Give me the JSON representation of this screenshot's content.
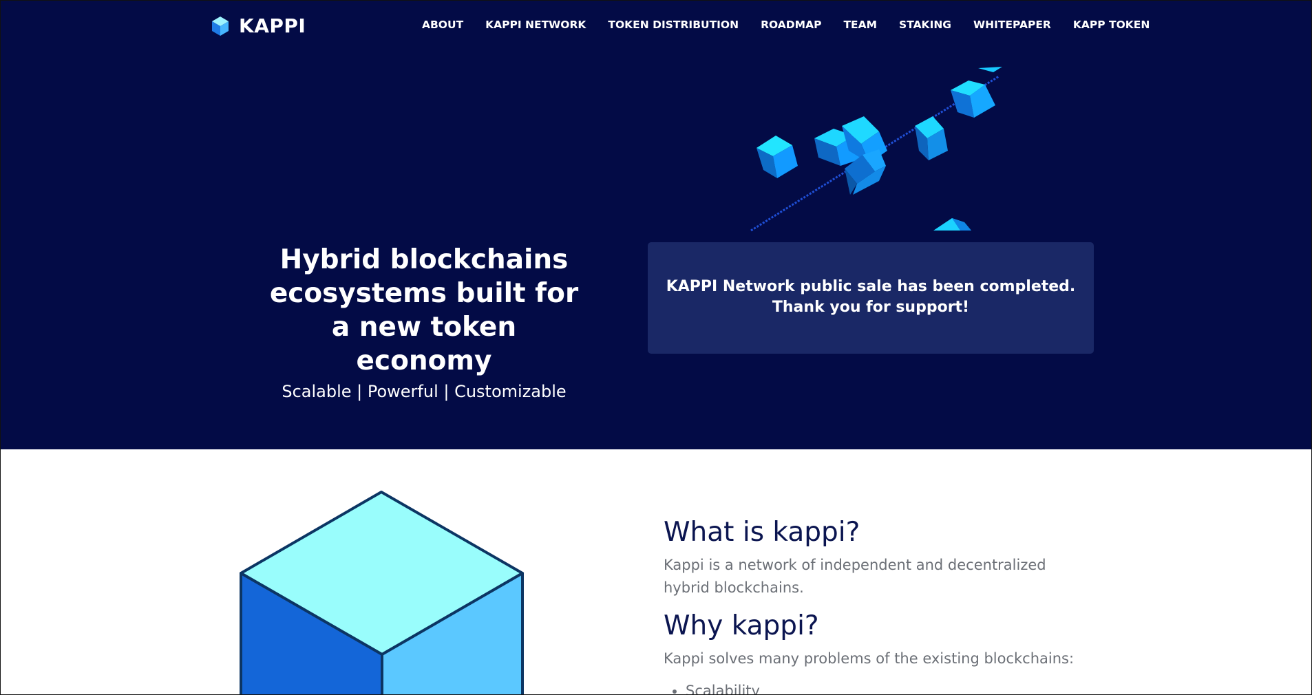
{
  "brand": {
    "name": "KAPPI",
    "icon": "cube-logo-icon"
  },
  "nav": {
    "items": [
      {
        "label": "ABOUT"
      },
      {
        "label": "KAPPI NETWORK"
      },
      {
        "label": "TOKEN DISTRIBUTION"
      },
      {
        "label": "ROADMAP"
      },
      {
        "label": "TEAM"
      },
      {
        "label": "STAKING"
      },
      {
        "label": "WHITEPAPER"
      },
      {
        "label": "KAPP TOKEN"
      }
    ]
  },
  "hero": {
    "title_line1": "Hybrid blockchains",
    "title_line2": "ecosystems built for",
    "title_line3": "a new token economy",
    "subtitle": "Scalable | Powerful | Customizable",
    "illustration": "floating-cubes-chain-illustration"
  },
  "notice": {
    "line1": "KAPPI Network public sale has been completed.",
    "line2": "Thank you for support!"
  },
  "about": {
    "illustration": "large-cube-illustration",
    "what_heading": "What is kappi?",
    "what_text": "Kappi is a network of independent and decentralized hybrid blockchains.",
    "why_heading": "Why kappi?",
    "why_text": "Kappi solves many problems of the existing blockchains:",
    "bullets": [
      "Scalability"
    ]
  },
  "colors": {
    "hero_bg": "#030b46",
    "notice_bg": "#1a2866",
    "heading": "#0b1550",
    "body_text": "#6b6f76",
    "cube_light": "#99fdfc",
    "cube_mid": "#5bc8ff",
    "cube_dark": "#1466d8"
  }
}
